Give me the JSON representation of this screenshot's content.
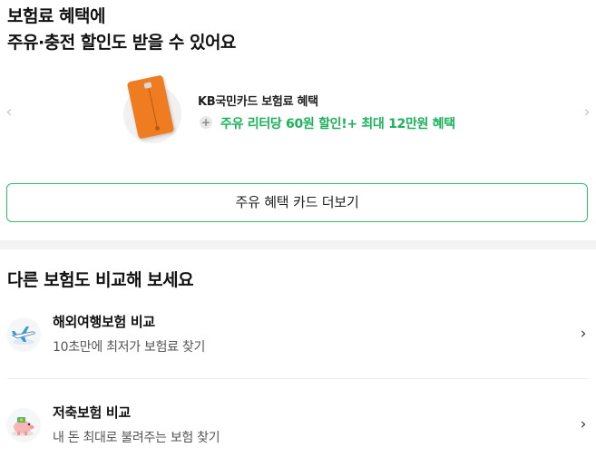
{
  "headline": {
    "line1": "보험료 혜택에",
    "line2": "주유·충전 할인도 받을 수 있어요"
  },
  "carousel": {
    "prev_icon": "‹",
    "next_icon": "›",
    "card": {
      "name": "KB국민카드 보험료 혜택",
      "plus_icon": "+",
      "benefit": "주유 리터당 60원 할인!+ 최대 12만원 혜택",
      "card_color": "#f07c22",
      "benefit_color": "#1bb35a"
    }
  },
  "more_button": {
    "label": "주유 혜택 카드 더보기",
    "border_color": "#2fbf6a"
  },
  "compare_section": {
    "title": "다른 보험도 비교해 보세요",
    "items": [
      {
        "icon": "airplane-icon",
        "title": "해외여행보험 비교",
        "subtitle": "10초만에 최저가 보험료 찾기",
        "chevron": "›"
      },
      {
        "icon": "piggy-bank-icon",
        "title": "저축보험 비교",
        "subtitle": "내 돈 최대로 불려주는 보험 찾기",
        "chevron": "›"
      }
    ]
  }
}
